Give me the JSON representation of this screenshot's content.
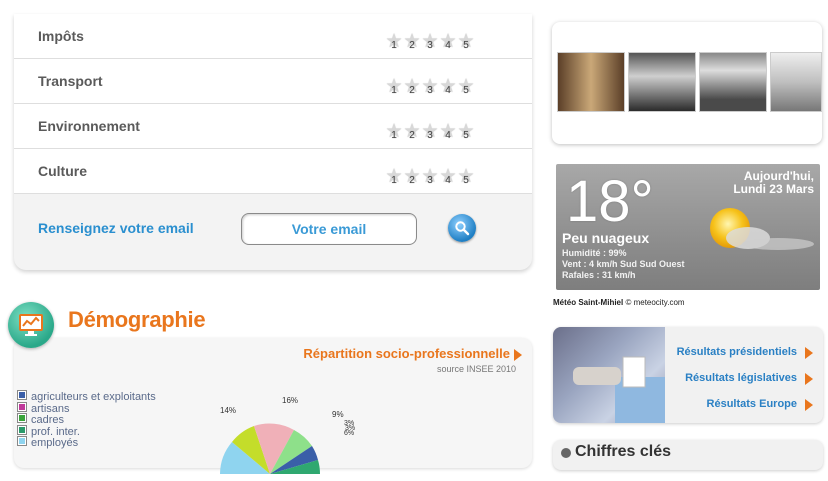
{
  "rating": {
    "rows": [
      {
        "label": "Impôts"
      },
      {
        "label": "Transport"
      },
      {
        "label": "Environnement"
      },
      {
        "label": "Culture"
      }
    ],
    "star_numbers": [
      "1",
      "2",
      "3",
      "4",
      "5"
    ],
    "email_label": "Renseignez votre email",
    "email_placeholder": "Votre email"
  },
  "demographie": {
    "title": "Démographie",
    "subtitle": "Répartition socio-professionnelle",
    "source": "source INSEE 2010",
    "legend": [
      {
        "label": "agriculteurs et exploitants",
        "color": "#3a5fa8"
      },
      {
        "label": "artisans",
        "color": "#c0399a"
      },
      {
        "label": "cadres",
        "color": "#39a43a"
      },
      {
        "label": "prof. inter.",
        "color": "#2a9a6a"
      },
      {
        "label": "employés",
        "color": "#8fd4ef"
      }
    ],
    "pie_labels": [
      "16%",
      "14%",
      "9%",
      "3%",
      "3%",
      "6%"
    ]
  },
  "meteo": {
    "temp": "18°",
    "date_line1": "Aujourd'hui,",
    "date_line2": "Lundi 23 Mars",
    "condition": "Peu nuageux",
    "humidity": "Humidité : 99%",
    "wind": "Vent : 4 km/h Sud Sud Ouest",
    "gusts": "Rafales : 31 km/h",
    "credit_bold": "Météo Saint-Mihiel",
    "credit_rest": " © meteocity.com"
  },
  "results": {
    "links": [
      "Résultats présidentiels",
      "Résultats législatives",
      "Résultats Europe"
    ]
  },
  "chiffres": {
    "title": "Chiffres clés"
  },
  "colors": {
    "accent_orange": "#e9761d",
    "link_blue": "#2a80c4"
  }
}
